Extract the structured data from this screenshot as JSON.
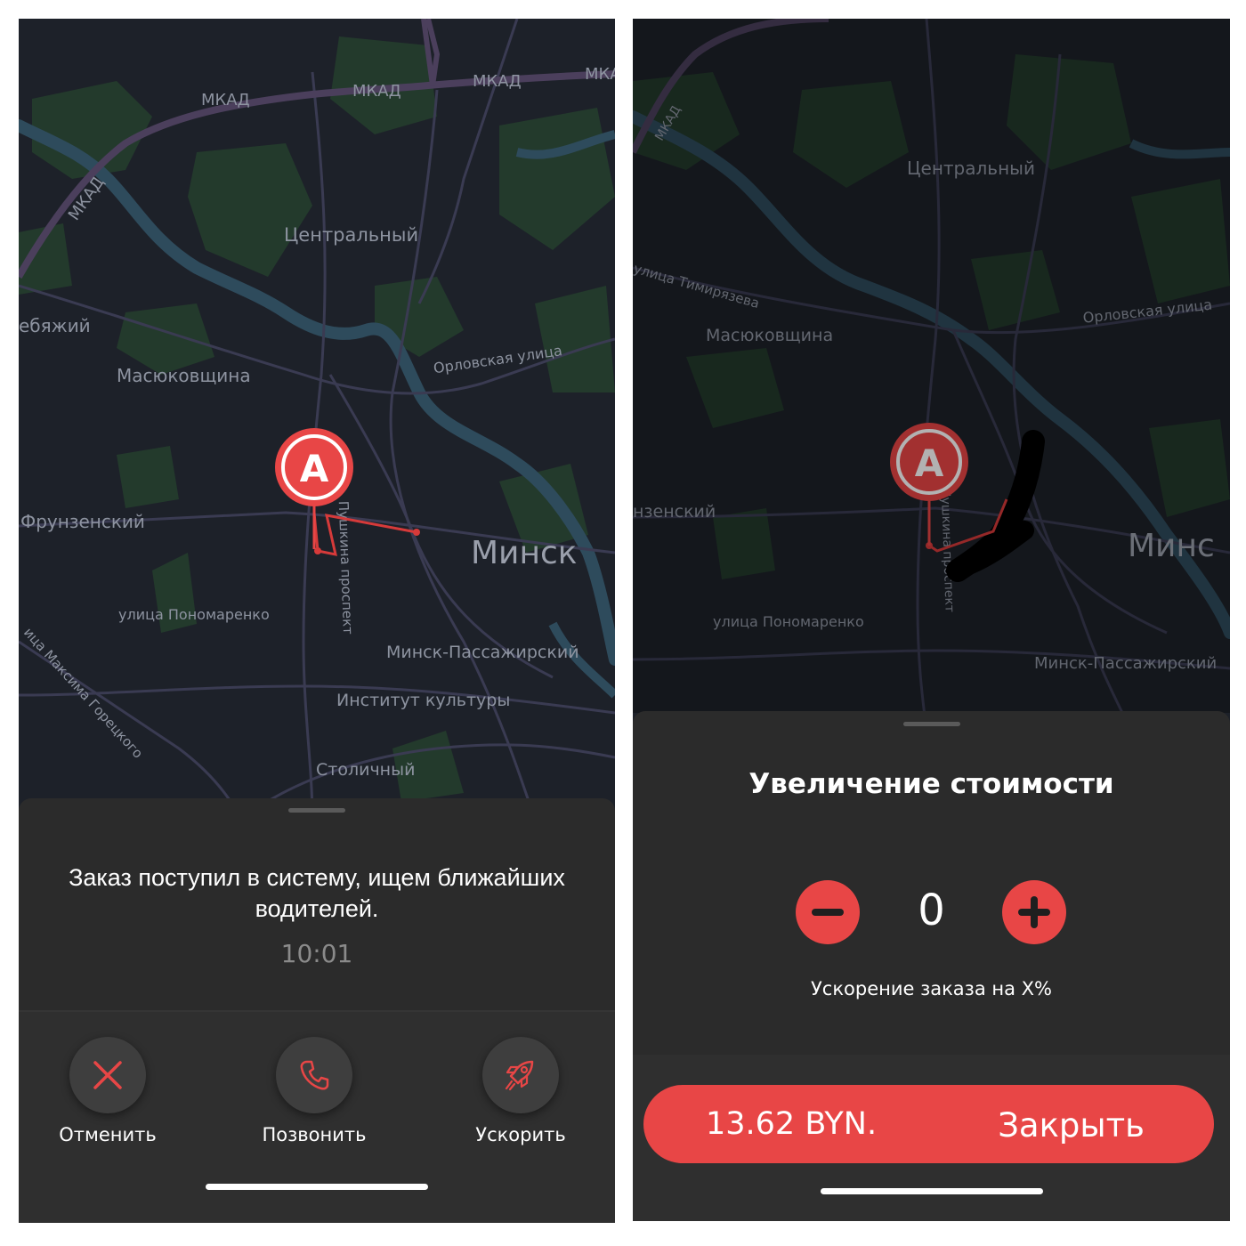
{
  "left_screen": {
    "map": {
      "labels": {
        "mkad_1": "МКАД",
        "mkad_2": "МКАД",
        "mkad_3": "МКАД",
        "mkad_4": "МКАД",
        "mkad_5": "МКАД",
        "mkad_6": "МКАД",
        "tsentralny": "Центральный",
        "lebyazhiy": "ебяжий",
        "masyukovshchina": "Масюковщина",
        "orlovskaya": "Орловская улица",
        "frunzensky": "Фрунзенский",
        "pushkina": "Пушкина проспект",
        "minsk": "Минск",
        "ponomarenko": "улица Пономаренко",
        "minsk_passazhirsky": "Минск-Пассажирский",
        "gorretskogo": "ица Максима Горецкого",
        "institut": "Институт культуры",
        "stolichny": "Столичный"
      },
      "marker_letter": "A"
    },
    "status": {
      "message": "Заказ поступил в систему, ищем ближайших водителей.",
      "time": "10:01"
    },
    "actions": [
      {
        "label": "Отменить",
        "icon": "close-icon"
      },
      {
        "label": "Позвонить",
        "icon": "phone-icon"
      },
      {
        "label": "Ускорить",
        "icon": "rocket-icon"
      }
    ]
  },
  "right_screen": {
    "map": {
      "labels": {
        "mkad": "МКАД",
        "tsentralny": "Центральный",
        "timiryazeva": "улица Тимирязева",
        "masyukovshchina": "Масюковщина",
        "orlovskaya": "Орловская улица",
        "frunzensky": "нзенский",
        "pushkina": "Пушкина проспект",
        "minsk": "Минс",
        "ponomarenko": "улица Пономаренко",
        "minsk_passazhirsky": "Минск-Пассажирский"
      },
      "marker_letter": "A"
    },
    "boost": {
      "title": "Увеличение стоимости",
      "value": "0",
      "caption": "Ускорение заказа на X%"
    },
    "payment": {
      "price": "13.62 BYN.",
      "close_label": "Закрыть"
    }
  },
  "colors": {
    "accent": "#e84646",
    "map_background": "#1c2027",
    "sheet_background": "#2b2b2b"
  }
}
